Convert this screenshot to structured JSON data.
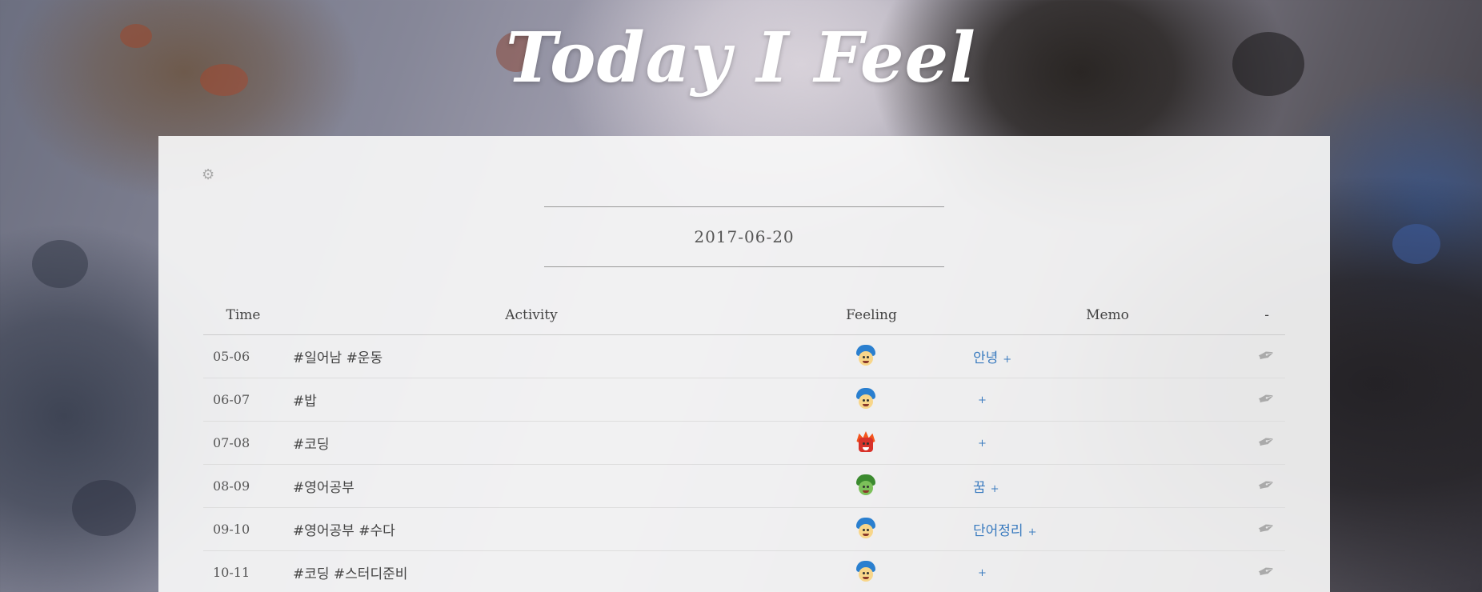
{
  "app": {
    "title": "Today I Feel"
  },
  "settings_icon": "gear-icon",
  "date": "2017-06-20",
  "table": {
    "headers": {
      "time": "Time",
      "activity": "Activity",
      "feeling": "Feeling",
      "memo": "Memo",
      "action": "-"
    },
    "rows": [
      {
        "time": "05-06",
        "activity": "#일어남 #운동",
        "feeling": "joy",
        "memo": "안녕",
        "memo_add": "+",
        "action_icon": "feather-pen-icon"
      },
      {
        "time": "06-07",
        "activity": "#밥",
        "feeling": "joy",
        "memo": "",
        "memo_add": "+",
        "action_icon": "feather-pen-icon"
      },
      {
        "time": "07-08",
        "activity": "#코딩",
        "feeling": "anger",
        "memo": "",
        "memo_add": "+",
        "action_icon": "feather-pen-icon"
      },
      {
        "time": "08-09",
        "activity": "#영어공부",
        "feeling": "disgust",
        "memo": "꿈",
        "memo_add": "+",
        "action_icon": "feather-pen-icon"
      },
      {
        "time": "09-10",
        "activity": "#영어공부 #수다",
        "feeling": "joy",
        "memo": "단어정리",
        "memo_add": "+",
        "action_icon": "feather-pen-icon"
      },
      {
        "time": "10-11",
        "activity": "#코딩 #스터디준비",
        "feeling": "joy",
        "memo": "",
        "memo_add": "+",
        "action_icon": "feather-pen-icon"
      }
    ]
  },
  "colors": {
    "link": "#3a7bbf",
    "panel_bg": "#f7f7f7",
    "title": "#ffffff"
  }
}
